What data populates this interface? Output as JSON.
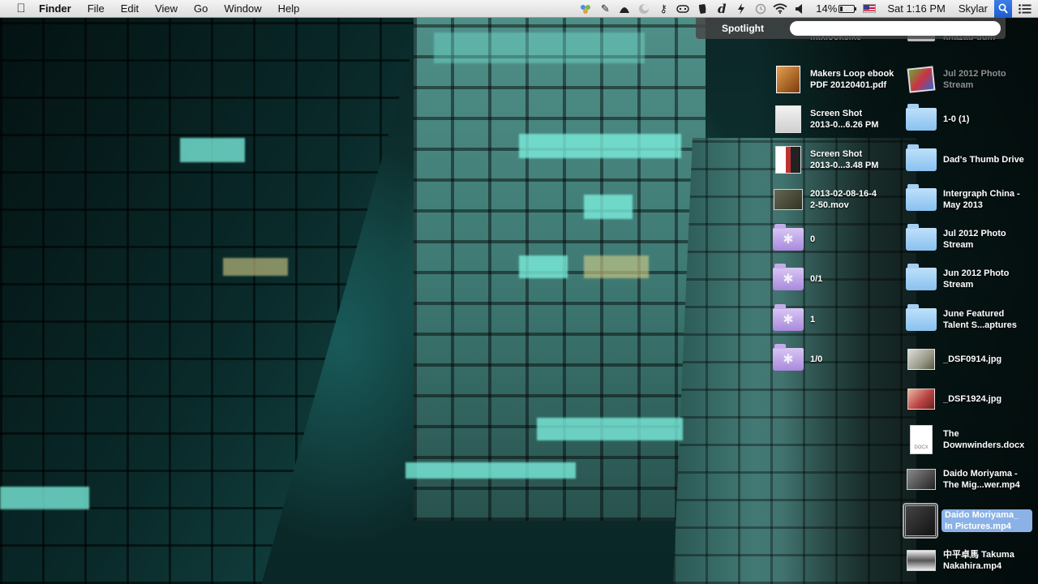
{
  "menubar": {
    "apple": "",
    "app_name": "Finder",
    "menus": [
      "File",
      "Edit",
      "View",
      "Go",
      "Window",
      "Help"
    ],
    "battery_percent": "14%",
    "battery_level": 0.14,
    "clock": "Sat 1:16 PM",
    "user": "Skylar",
    "evernote_glyph": "d"
  },
  "spotlight": {
    "label": "Spotlight",
    "query": ""
  },
  "desktop": {
    "left_column": [
      {
        "name": "mixlooksike",
        "kind": "partial"
      },
      {
        "name": "Makers Loop ebook\nPDF 20120401.pdf",
        "kind": "pdf"
      },
      {
        "name": "Screen Shot\n2013-0...6.26 PM",
        "kind": "shot"
      },
      {
        "name": "Screen Shot\n2013-0...3.48 PM",
        "kind": "shot-photo"
      },
      {
        "name": "2013-02-08-16-4\n2-50.mov",
        "kind": "video"
      },
      {
        "name": "0",
        "kind": "folder-purple"
      },
      {
        "name": "0/1",
        "kind": "folder-purple"
      },
      {
        "name": "1",
        "kind": "folder-purple"
      },
      {
        "name": "1/0",
        "kind": "folder-purple"
      }
    ],
    "right_column": [
      {
        "name": "khazad-dum",
        "kind": "partial"
      },
      {
        "name": "Jul 2012 Photo\nStream",
        "kind": "photo-app"
      },
      {
        "name": "1-0 (1)",
        "kind": "folder-blue"
      },
      {
        "name": "Dad's Thumb Drive",
        "kind": "folder-blue"
      },
      {
        "name": "Intergraph China -\nMay 2013",
        "kind": "folder-blue"
      },
      {
        "name": "Jul 2012 Photo\nStream",
        "kind": "folder-blue"
      },
      {
        "name": "Jun 2012 Photo\nStream",
        "kind": "folder-blue"
      },
      {
        "name": "June Featured\nTalent S...aptures",
        "kind": "folder-blue"
      },
      {
        "name": "_DSF0914.jpg",
        "kind": "image"
      },
      {
        "name": "_DSF1924.jpg",
        "kind": "image-red"
      },
      {
        "name": "The\nDownwinders.docx",
        "kind": "doc"
      },
      {
        "name": "Daido Moriyama -\nThe Mig...wer.mp4",
        "kind": "video"
      },
      {
        "name": "Daido Moriyama_\nIn Pictures.mp4",
        "kind": "video-selected"
      },
      {
        "name": "中平卓馬 Takuma\nNakahira.mp4",
        "kind": "video-mono"
      }
    ],
    "docx_badge": "DOCX"
  },
  "colors": {
    "selection": "#8ab2e6",
    "spotlight_blue": "#1c5bd0",
    "folder_blue": "#88c1ef",
    "folder_purple": "#a889dd"
  }
}
